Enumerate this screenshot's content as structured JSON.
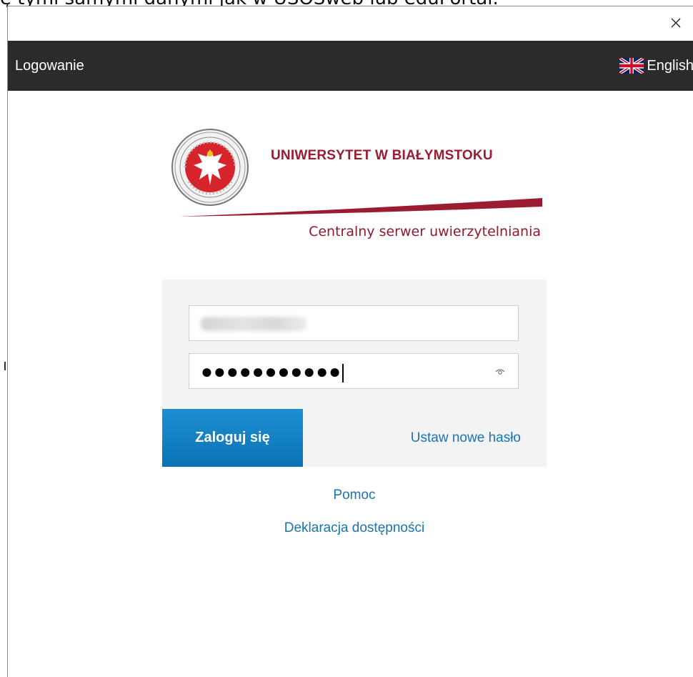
{
  "background_text": "ę tymi samymi danymi jak w USOSweb lub eduPortal.",
  "dialog": {
    "close_icon": "close-icon",
    "header": {
      "title": "Logowanie",
      "language_label": "English",
      "language_icon": "uk-flag-icon"
    },
    "logo": {
      "university_name": "UNIWERSYTET W BIAŁYMSTOKU",
      "subtitle": "Centralny serwer uwierzytelniania",
      "seal_icon": "university-seal-icon",
      "brand_color": "#9b1b30"
    },
    "form": {
      "username_value": "",
      "password_mask": "●●●●●●●●●●●",
      "show_password_icon": "eye-icon",
      "login_button": "Zaloguj się",
      "reset_password_link": "Ustaw nowe hasło",
      "button_color": "#0a73b4"
    },
    "footer_links": {
      "help": "Pomoc",
      "accessibility": "Deklaracja dostępności",
      "link_color": "#1a74b0"
    }
  }
}
